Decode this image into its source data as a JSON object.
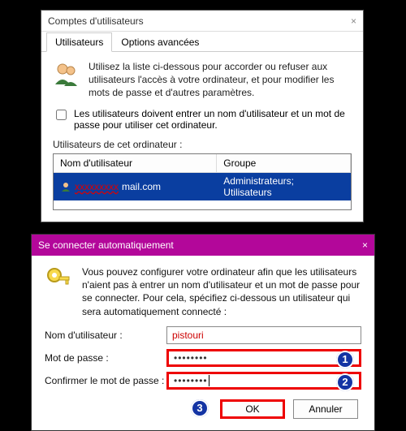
{
  "window1": {
    "title": "Comptes d'utilisateurs",
    "close": "×",
    "tabs": {
      "users": "Utilisateurs",
      "advanced": "Options avancées"
    },
    "intro": "Utilisez la liste ci-dessous pour accorder ou refuser aux utilisateurs l'accès à votre ordinateur, et pour modifier les mots de passe et d'autres paramètres.",
    "check_label": "Les utilisateurs doivent entrer un nom d'utilisateur et un mot de passe pour utiliser cet ordinateur.",
    "list_label": "Utilisateurs de cet ordinateur :",
    "columns": {
      "user": "Nom d'utilisateur",
      "group": "Groupe"
    },
    "rows": [
      {
        "user_prefix": "xxxxxxxxx",
        "user_suffix": "mail.com",
        "group": "Administrateurs; Utilisateurs"
      }
    ]
  },
  "window2": {
    "title": "Se connecter automatiquement",
    "close": "×",
    "intro": "Vous pouvez configurer votre ordinateur afin que les utilisateurs n'aient pas à entrer un nom d'utilisateur et un mot de passe pour se connecter. Pour cela, spécifiez ci-dessous un utilisateur qui sera automatiquement connecté :",
    "labels": {
      "username": "Nom d'utilisateur :",
      "password": "Mot de passe :",
      "confirm": "Confirmer le mot de passe :"
    },
    "values": {
      "username": "pistouri",
      "password_mask": "••••••••",
      "confirm_mask": "••••••••"
    },
    "buttons": {
      "ok": "OK",
      "cancel": "Annuler"
    },
    "callouts": {
      "c1": "1",
      "c2": "2",
      "c3": "3"
    }
  }
}
